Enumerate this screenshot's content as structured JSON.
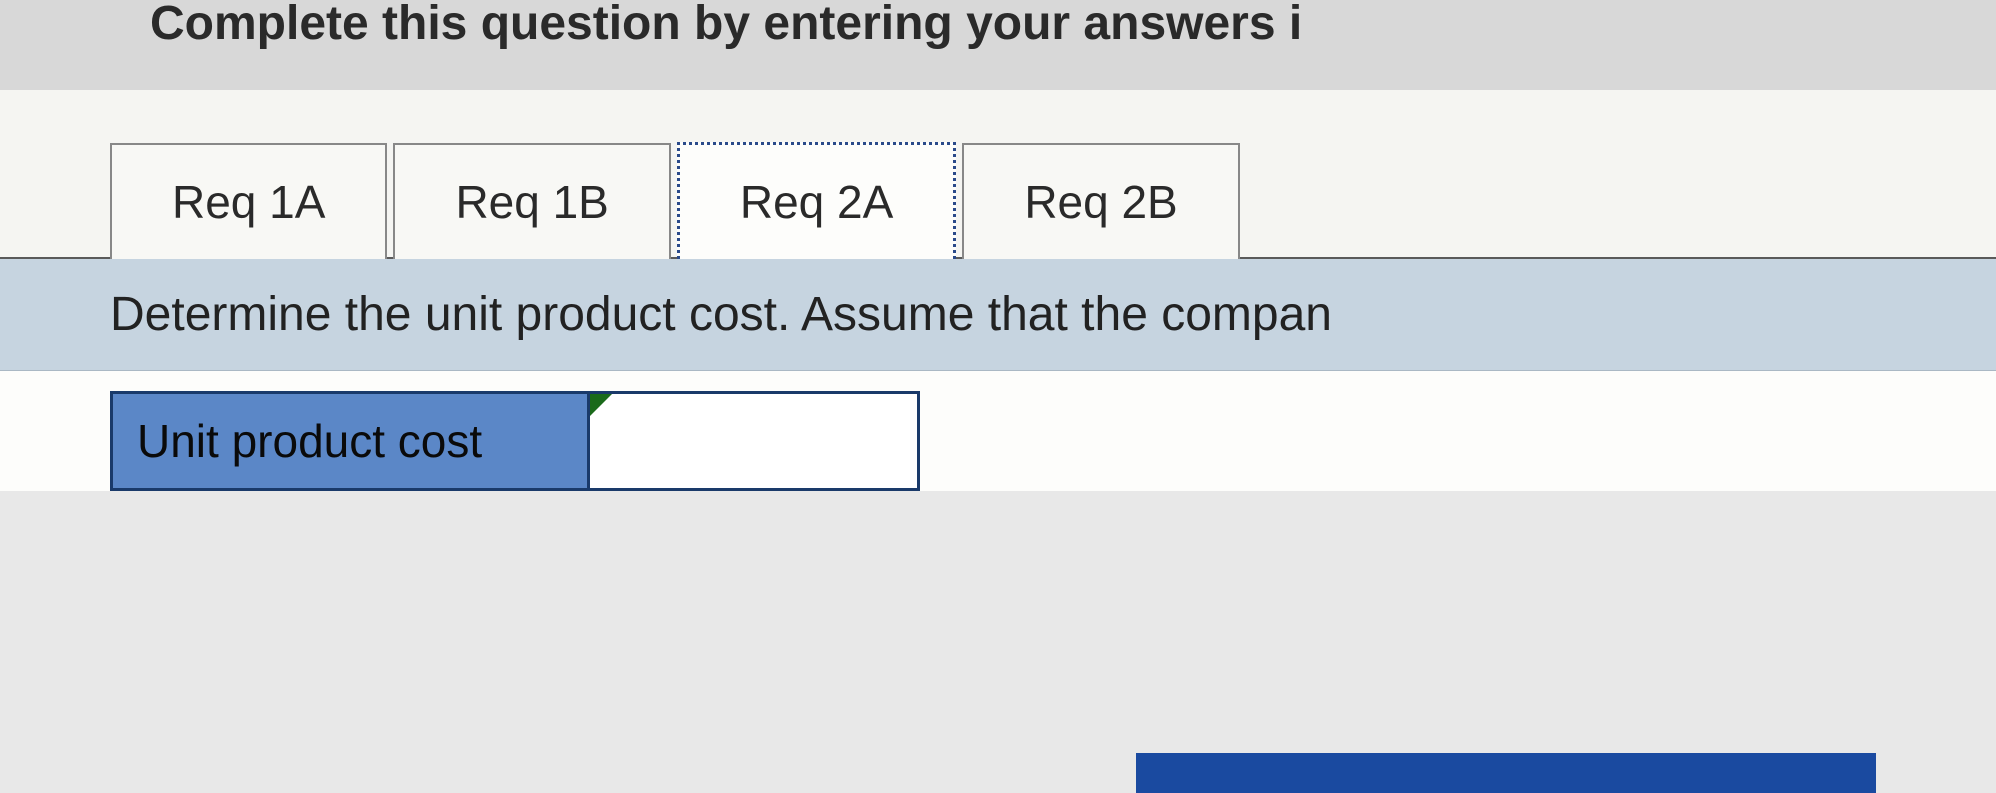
{
  "instruction": "Complete this question by entering your answers i",
  "tabs": [
    {
      "label": "Req 1A",
      "active": false
    },
    {
      "label": "Req 1B",
      "active": false
    },
    {
      "label": "Req 2A",
      "active": true
    },
    {
      "label": "Req 2B",
      "active": false
    }
  ],
  "prompt": "Determine the unit product cost. Assume that the compan",
  "answer": {
    "label": "Unit product cost",
    "value": ""
  }
}
